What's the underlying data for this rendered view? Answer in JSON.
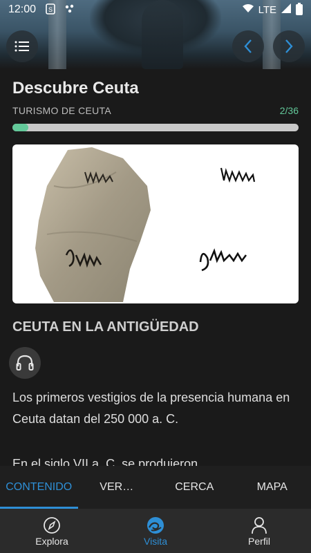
{
  "status_bar": {
    "time": "12:00",
    "network": "LTE"
  },
  "header": {
    "title": "Descubre Ceuta",
    "subtitle": "TURISMO DE CEUTA",
    "counter": "2/36",
    "progress_fraction": 0.0556
  },
  "section": {
    "title": "CEUTA EN LA ANTIGÜEDAD",
    "paragraph1": "Los primeros vestigios de la presencia humana en Ceuta datan del 250 000 a. C.",
    "paragraph2": "En el siglo VII a. C. se produjeron"
  },
  "tabs": [
    {
      "label": "CONTENIDO",
      "active": true
    },
    {
      "label": "VER…",
      "active": false
    },
    {
      "label": "CERCA",
      "active": false
    },
    {
      "label": "MAPA",
      "active": false
    }
  ],
  "bottom_nav": [
    {
      "label": "Explora",
      "icon": "compass-icon",
      "active": false
    },
    {
      "label": "Visita",
      "icon": "wave-icon",
      "active": true
    },
    {
      "label": "Perfil",
      "icon": "person-icon",
      "active": false
    }
  ],
  "colors": {
    "accent": "#2e8fd6",
    "progress": "#63c99a"
  }
}
